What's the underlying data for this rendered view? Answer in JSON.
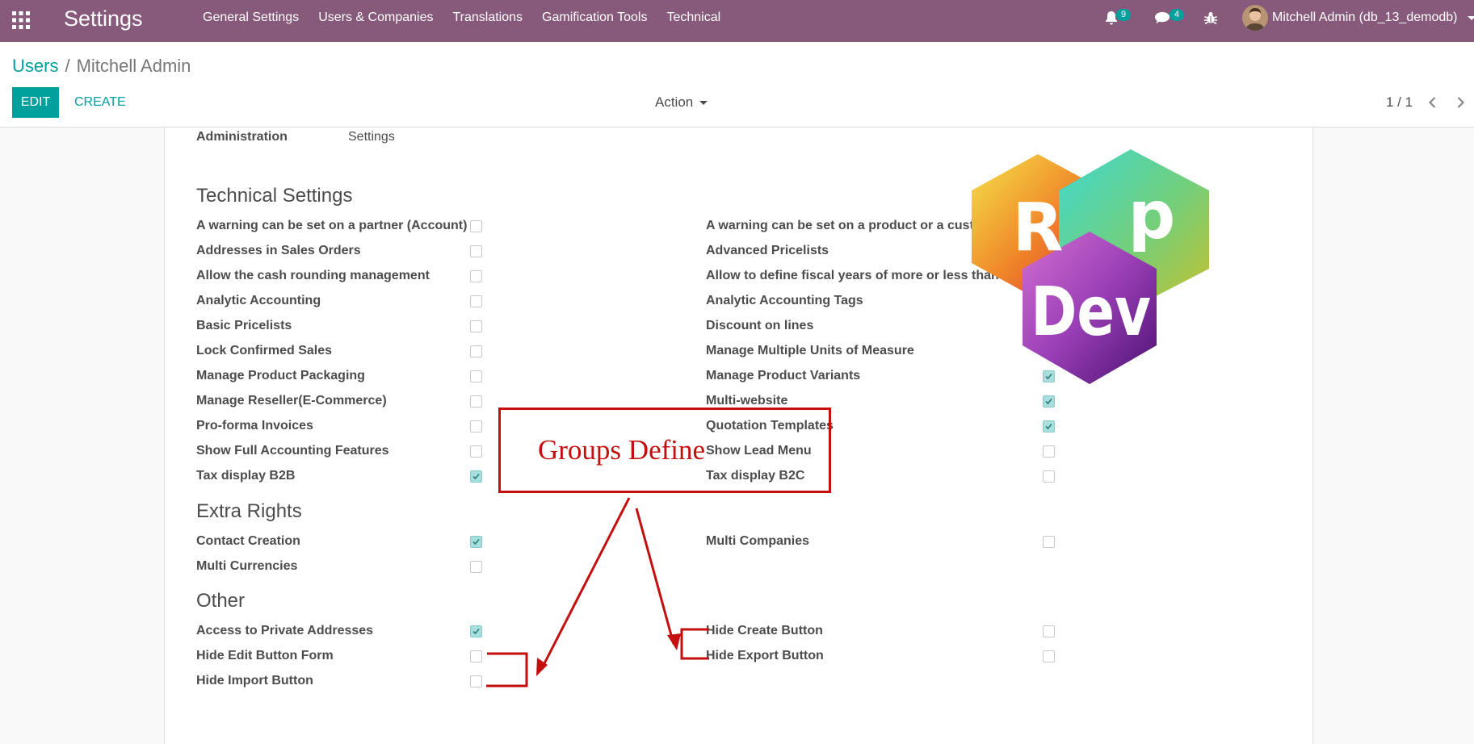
{
  "navbar": {
    "app_title": "Settings",
    "menu": [
      "General Settings",
      "Users & Companies",
      "Translations",
      "Gamification Tools",
      "Technical"
    ],
    "notifications_count": "9",
    "messages_count": "4",
    "user_label": "Mitchell Admin (db_13_demodb)",
    "icons": [
      "apps-grid-icon",
      "bell-icon",
      "chat-icon",
      "bug-icon",
      "user-avatar"
    ],
    "color": "#875a7b"
  },
  "control_panel": {
    "breadcrumb_parent": "Users",
    "breadcrumb_sep": "/",
    "breadcrumb_current": "Mitchell Admin",
    "edit_label": "EDIT",
    "create_label": "CREATE",
    "action_label": "Action",
    "pager_value": "1 / 1",
    "accent_color": "#00a09d"
  },
  "form": {
    "top_row": {
      "label": "Administration",
      "value": "Settings"
    },
    "technical_title": "Technical Settings",
    "technical_left": [
      {
        "label": "A warning can be set on a partner (Account)",
        "checked": false
      },
      {
        "label": "Addresses in Sales Orders",
        "checked": false
      },
      {
        "label": "Allow the cash rounding management",
        "checked": false
      },
      {
        "label": "Analytic Accounting",
        "checked": false
      },
      {
        "label": "Basic Pricelists",
        "checked": false
      },
      {
        "label": "Lock Confirmed Sales",
        "checked": false
      },
      {
        "label": "Manage Product Packaging",
        "checked": false
      },
      {
        "label": "Manage Reseller(E-Commerce)",
        "checked": false
      },
      {
        "label": "Pro-forma Invoices",
        "checked": false
      },
      {
        "label": "Show Full Accounting Features",
        "checked": false
      },
      {
        "label": "Tax display B2B",
        "checked": true
      }
    ],
    "technical_right": [
      {
        "label": "A warning can be set on a product or a custom",
        "checked": null
      },
      {
        "label": "Advanced Pricelists",
        "checked": null
      },
      {
        "label": "Allow to define fiscal years of more or less than a",
        "checked": null
      },
      {
        "label": "Analytic Accounting Tags",
        "checked": null
      },
      {
        "label": "Discount on lines",
        "checked": null
      },
      {
        "label": "Manage Multiple Units of Measure",
        "checked": null
      },
      {
        "label": "Manage Product Variants",
        "checked": true
      },
      {
        "label": "Multi-website",
        "checked": true
      },
      {
        "label": "Quotation Templates",
        "checked": true
      },
      {
        "label": "Show Lead Menu",
        "checked": false
      },
      {
        "label": "Tax display B2C",
        "checked": false
      }
    ],
    "extra_title": "Extra Rights",
    "extra_left": [
      {
        "label": "Contact Creation",
        "checked": true
      },
      {
        "label": "Multi Currencies",
        "checked": false
      }
    ],
    "extra_right": [
      {
        "label": "Multi Companies",
        "checked": false
      }
    ],
    "other_title": "Other",
    "other_left": [
      {
        "label": "Access to Private Addresses",
        "checked": true
      },
      {
        "label": "Hide Edit Button Form",
        "checked": false
      },
      {
        "label": "Hide Import Button",
        "checked": false
      }
    ],
    "other_right": [
      {
        "label": "Hide Create Button",
        "checked": false
      },
      {
        "label": "Hide Export Button",
        "checked": false
      }
    ]
  },
  "annotation": {
    "text": "Groups Define",
    "color": "#c40f0f"
  },
  "logo": {
    "letters": [
      "R",
      "p",
      "Dev"
    ]
  }
}
